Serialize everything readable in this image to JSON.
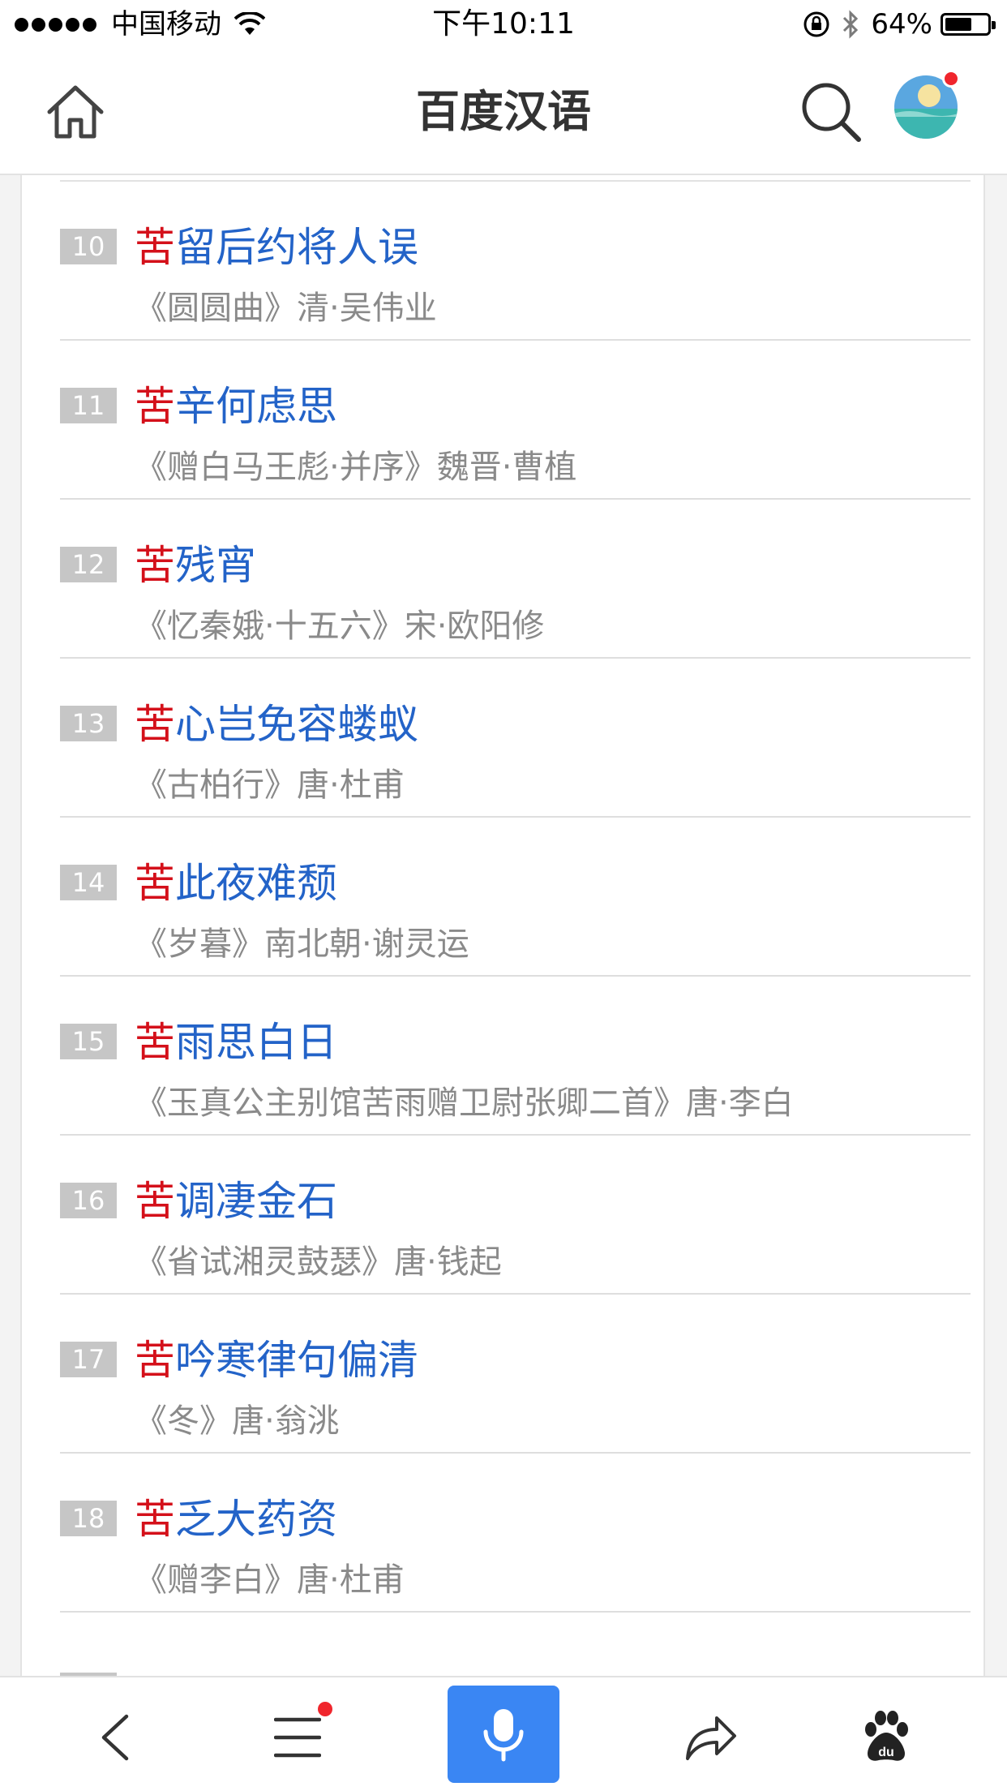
{
  "status_bar": {
    "carrier": "中国移动",
    "time": "下午10:11",
    "battery_percent": "64%",
    "battery_level": 0.64
  },
  "header": {
    "title": "百度汉语"
  },
  "poems": [
    {
      "num": "10",
      "head": "苦",
      "rest": "留后约将人误",
      "source": "《圆圆曲》清·吴伟业"
    },
    {
      "num": "11",
      "head": "苦",
      "rest": "辛何虑思",
      "source": "《赠白马王彪·并序》魏晋·曹植"
    },
    {
      "num": "12",
      "head": "苦",
      "rest": "残宵",
      "source": "《忆秦娥·十五六》宋·欧阳修"
    },
    {
      "num": "13",
      "head": "苦",
      "rest": "心岂免容蝼蚁",
      "source": "《古柏行》唐·杜甫"
    },
    {
      "num": "14",
      "head": "苦",
      "rest": "此夜难颓",
      "source": "《岁暮》南北朝·谢灵运"
    },
    {
      "num": "15",
      "head": "苦",
      "rest": "雨思白日",
      "source": "《玉真公主别馆苦雨赠卫尉张卿二首》唐·李白"
    },
    {
      "num": "16",
      "head": "苦",
      "rest": "调凄金石",
      "source": "《省试湘灵鼓瑟》唐·钱起"
    },
    {
      "num": "17",
      "head": "苦",
      "rest": "吟寒律句偏清",
      "source": "《冬》唐·翁洮"
    },
    {
      "num": "18",
      "head": "苦",
      "rest": "乏大药资",
      "source": "《赠李白》唐·杜甫"
    }
  ],
  "colors": {
    "highlight": "#d4101a",
    "link": "#2363c8",
    "source_text": "#8a8a8a",
    "accent_blue": "#3a86f3",
    "notification_red": "#f0262d"
  }
}
